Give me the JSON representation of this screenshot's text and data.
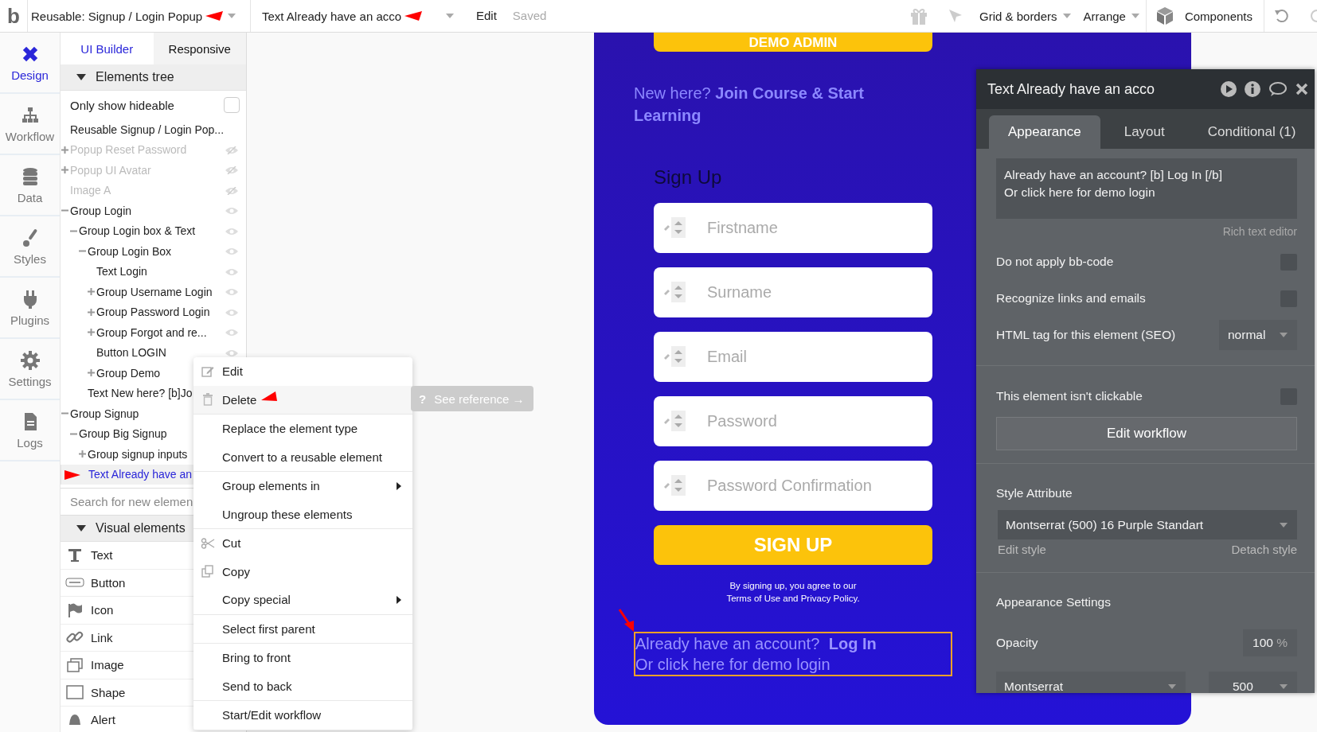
{
  "topbar": {
    "logo": "b",
    "page_selector": "Reusable: Signup / Login Popup",
    "element_selector": "Text Already have an acco",
    "menu": [
      {
        "label": "Edit",
        "disabled": false
      },
      {
        "label": "Saved",
        "disabled": true
      }
    ],
    "tools": [
      {
        "label": "Grid & borders"
      },
      {
        "label": "Arrange"
      }
    ],
    "components": "Components"
  },
  "rail": [
    {
      "label": "Design",
      "kind": "design",
      "selected": true
    },
    {
      "label": "Workflow",
      "kind": "workflow",
      "selected": false
    },
    {
      "label": "Data",
      "kind": "data",
      "selected": false
    },
    {
      "label": "Styles",
      "kind": "styles",
      "selected": false
    },
    {
      "label": "Plugins",
      "kind": "plugins",
      "selected": false
    },
    {
      "label": "Settings",
      "kind": "settings",
      "selected": false
    },
    {
      "label": "Logs",
      "kind": "logs",
      "selected": false
    }
  ],
  "panel": {
    "tabs": [
      {
        "label": "UI Builder",
        "selected": true
      },
      {
        "label": "Responsive",
        "selected": false
      }
    ],
    "tree_header": "Elements tree",
    "hideable": {
      "label": "Only show hideable",
      "checked": false
    },
    "tree": {
      "label": "Reusable Signup / Login Pop...",
      "hidden": false,
      "selected": false,
      "children": [
        {
          "label": "Popup Reset Password",
          "hidden": true,
          "selected": false,
          "expanded": false
        },
        {
          "label": "Popup UI Avatar",
          "hidden": true,
          "selected": false,
          "expanded": false
        },
        {
          "label": "Image A",
          "hidden": true,
          "selected": false
        },
        {
          "label": "Group Login",
          "hidden": false,
          "selected": false,
          "expanded": true,
          "children": [
            {
              "label": "Group Login box & Text",
              "hidden": false,
              "selected": false,
              "expanded": true,
              "children": [
                {
                  "label": "Group Login Box",
                  "hidden": false,
                  "selected": false,
                  "expanded": true,
                  "children": [
                    {
                      "label": "Text Login",
                      "hidden": false,
                      "selected": false
                    },
                    {
                      "label": "Group Username Login",
                      "hidden": false,
                      "selected": false,
                      "expanded": false
                    },
                    {
                      "label": "Group Password Login",
                      "hidden": false,
                      "selected": false,
                      "expanded": false
                    },
                    {
                      "label": "Group Forgot and re...",
                      "hidden": false,
                      "selected": false,
                      "expanded": false
                    },
                    {
                      "label": "Button LOGIN",
                      "hidden": false,
                      "selected": false
                    },
                    {
                      "label": "Group Demo",
                      "hidden": false,
                      "selected": false,
                      "expanded": false
                    }
                  ]
                },
                {
                  "label": "Text New here? [b]Jo",
                  "hidden": false,
                  "selected": false
                }
              ]
            }
          ]
        },
        {
          "label": "Group Signup",
          "hidden": false,
          "selected": false,
          "expanded": true,
          "children": [
            {
              "label": "Group Big Signup",
              "hidden": false,
              "selected": false,
              "expanded": true,
              "children": [
                {
                  "label": "Group signup inputs",
                  "hidden": false,
                  "selected": false,
                  "expanded": false
                },
                {
                  "label": "Text Already have an",
                  "hidden": false,
                  "selected": true
                }
              ]
            }
          ]
        }
      ]
    },
    "search": {
      "placeholder": "Search for new elemen"
    },
    "visual_header": "Visual elements",
    "visual_elements": [
      {
        "label": "Text",
        "kind": "text"
      },
      {
        "label": "Button",
        "kind": "button"
      },
      {
        "label": "Icon",
        "kind": "icon"
      },
      {
        "label": "Link",
        "kind": "link"
      },
      {
        "label": "Image",
        "kind": "image"
      },
      {
        "label": "Shape",
        "kind": "shape"
      },
      {
        "label": "Alert",
        "kind": "alert"
      }
    ]
  },
  "popup": {
    "demo_button": "DEMO ADMIN",
    "intro": "New here? **Join Course & Start Learning**",
    "heading": "Sign Up",
    "inputs": [
      {
        "placeholder": "Firstname"
      },
      {
        "placeholder": "Surname"
      },
      {
        "placeholder": "Email"
      },
      {
        "placeholder": "Password"
      },
      {
        "placeholder": "Password Confirmation"
      }
    ],
    "submit": "SIGN UP",
    "terms": [
      "By signing up, you agree to our",
      "Terms of Use and Privacy Policy."
    ],
    "selected_text": {
      "lines": [
        "Already have an account?  **Log In**",
        "Or click here for demo login"
      ],
      "selected": true
    }
  },
  "context_menu": {
    "groups": [
      [
        {
          "label": "Edit",
          "kind": "edit",
          "highlighted": false,
          "submenu": false
        },
        {
          "label": "Delete",
          "kind": "delete",
          "highlighted": true,
          "submenu": false
        }
      ],
      [
        {
          "label": "Replace the element type",
          "kind": "plain",
          "highlighted": false,
          "submenu": false
        },
        {
          "label": "Convert to a reusable element",
          "kind": "plain",
          "highlighted": false,
          "submenu": false
        }
      ],
      [
        {
          "label": "Group elements in",
          "kind": "plain",
          "highlighted": false,
          "submenu": true
        },
        {
          "label": "Ungroup these elements",
          "kind": "plain",
          "highlighted": false,
          "submenu": false
        }
      ],
      [
        {
          "label": "Cut",
          "kind": "cut",
          "highlighted": false,
          "submenu": false
        },
        {
          "label": "Copy",
          "kind": "copy",
          "highlighted": false,
          "submenu": false
        },
        {
          "label": "Copy special",
          "kind": "plain",
          "highlighted": false,
          "submenu": true
        }
      ],
      [
        {
          "label": "Select first parent",
          "kind": "plain",
          "highlighted": false,
          "submenu": false
        }
      ],
      [
        {
          "label": "Bring to front",
          "kind": "plain",
          "highlighted": false,
          "submenu": false
        },
        {
          "label": "Send to back",
          "kind": "plain",
          "highlighted": false,
          "submenu": false
        }
      ],
      [
        {
          "label": "Start/Edit workflow",
          "kind": "plain",
          "highlighted": false,
          "submenu": false
        }
      ]
    ]
  },
  "tooltip": {
    "icon": "?",
    "label": "See reference →"
  },
  "inspector": {
    "title": "Text Already have an acco",
    "tabs": [
      {
        "label": "Appearance",
        "selected": true
      },
      {
        "label": "Layout",
        "selected": false
      },
      {
        "label": "Conditional (1)",
        "selected": false
      }
    ],
    "content": [
      "Already have an account? [b] Log In [/b]",
      "Or click here for demo login"
    ],
    "rich_text_link": "Rich text editor",
    "options": [
      {
        "kind": "checkbox",
        "label": "Do not apply bb-code",
        "checked": false
      },
      {
        "kind": "checkbox",
        "label": "Recognize links and emails",
        "checked": false
      },
      {
        "kind": "select",
        "label": "HTML tag for this element (SEO)",
        "value": "normal"
      }
    ],
    "clickable": {
      "label": "This element isn't clickable",
      "checked": false
    },
    "workflow_button": "Edit workflow",
    "style": {
      "label": "Style Attribute",
      "value": "Montserrat (500) 16 Purple Standart",
      "edit": "Edit style",
      "detach": "Detach style"
    },
    "appearance_heading": "Appearance Settings",
    "opacity": {
      "label": "Opacity",
      "value": "100",
      "unit": "%"
    },
    "font": {
      "family": "Montserrat",
      "weight": "500"
    }
  }
}
